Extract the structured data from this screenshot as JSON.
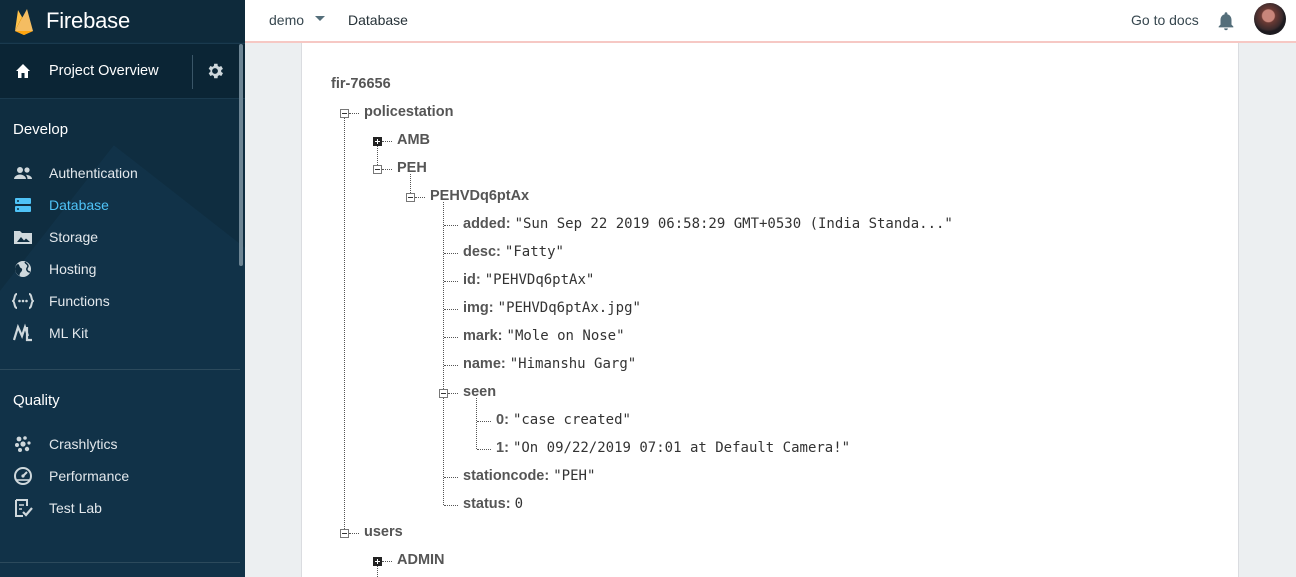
{
  "sidebar": {
    "brand": "Firebase",
    "overview": "Project Overview",
    "sections": [
      {
        "title": "Develop",
        "items": [
          {
            "label": "Authentication",
            "icon": "people-icon"
          },
          {
            "label": "Database",
            "icon": "database-icon",
            "active": true
          },
          {
            "label": "Storage",
            "icon": "image-icon"
          },
          {
            "label": "Hosting",
            "icon": "globe-icon"
          },
          {
            "label": "Functions",
            "icon": "functions-icon"
          },
          {
            "label": "ML Kit",
            "icon": "mlkit-icon"
          }
        ]
      },
      {
        "title": "Quality",
        "items": [
          {
            "label": "Crashlytics",
            "icon": "crashlytics-icon"
          },
          {
            "label": "Performance",
            "icon": "speedometer-icon"
          },
          {
            "label": "Test Lab",
            "icon": "checklist-icon"
          }
        ]
      }
    ]
  },
  "topbar": {
    "project": "demo",
    "page": "Database",
    "docs": "Go to docs"
  },
  "tree": {
    "root": "fir-76656",
    "policestation": "policestation",
    "amb": "AMB",
    "peh": "PEH",
    "record_key": "PEHVDq6ptAx",
    "fields": [
      {
        "key": "added:",
        "value": "\"Sun Sep 22 2019 06:58:29 GMT+0530 (India Standa...\""
      },
      {
        "key": "desc:",
        "value": "\"Fatty\""
      },
      {
        "key": "id:",
        "value": "\"PEHVDq6ptAx\""
      },
      {
        "key": "img:",
        "value": "\"PEHVDq6ptAx.jpg\""
      },
      {
        "key": "mark:",
        "value": "\"Mole on Nose\""
      },
      {
        "key": "name:",
        "value": "\"Himanshu Garg\""
      }
    ],
    "seen_key": "seen",
    "seen": [
      {
        "key": "0:",
        "value": "\"case created\""
      },
      {
        "key": "1:",
        "value": "\"On 09/22/2019 07:01 at Default Camera!\""
      }
    ],
    "stationcode": {
      "key": "stationcode:",
      "value": "\"PEH\""
    },
    "status": {
      "key": "status:",
      "value": "0"
    },
    "users": "users",
    "admin": "ADMIN"
  },
  "colors": {
    "sidebar_bg": "#0f2d40",
    "active": "#4fc3f7",
    "topbar_accent": "#f6c8c4"
  }
}
